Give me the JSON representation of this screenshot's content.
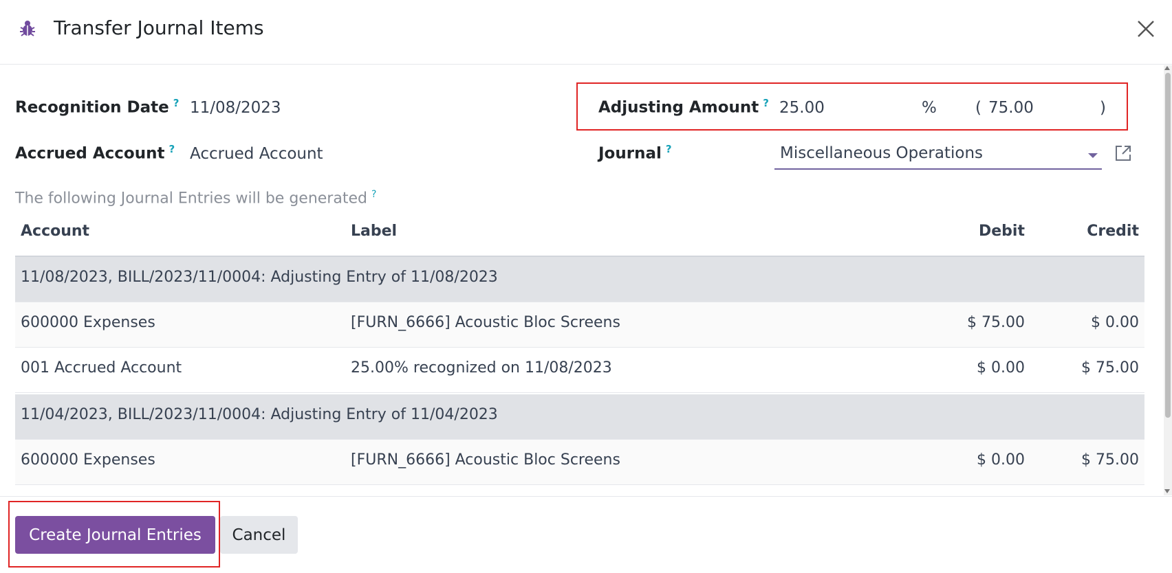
{
  "dialog": {
    "title": "Transfer Journal Items"
  },
  "form": {
    "recognition_date_label": "Recognition Date",
    "recognition_date_value": "11/08/2023",
    "accrued_account_label": "Accrued Account",
    "accrued_account_value": "Accrued Account",
    "adjusting_amount_label": "Adjusting Amount",
    "adjusting_amount_value": "25.00",
    "percent_symbol": "%",
    "amount_open_paren": "(",
    "amount_computed": "75.00",
    "amount_close_paren": ")",
    "journal_label": "Journal",
    "journal_value": "Miscellaneous Operations",
    "help_mark": "?"
  },
  "info_text": "The following Journal Entries will be generated",
  "table": {
    "columns": [
      "Account",
      "Label",
      "Debit",
      "Credit"
    ],
    "rows": [
      {
        "type": "group",
        "text": "11/08/2023, BILL/2023/11/0004: Adjusting Entry of 11/08/2023"
      },
      {
        "type": "line",
        "account": "600000 Expenses",
        "label": "[FURN_6666] Acoustic Bloc Screens",
        "debit": "$ 75.00",
        "credit": "$ 0.00"
      },
      {
        "type": "line",
        "account": "001 Accrued Account",
        "label": "25.00% recognized on 11/08/2023",
        "debit": "$ 0.00",
        "credit": "$ 75.00"
      },
      {
        "type": "group",
        "text": "11/04/2023, BILL/2023/11/0004: Adjusting Entry of 11/04/2023"
      },
      {
        "type": "line",
        "account": "600000 Expenses",
        "label": "[FURN_6666] Acoustic Bloc Screens",
        "debit": "$ 0.00",
        "credit": "$ 75.00"
      }
    ]
  },
  "footer": {
    "create_label": "Create Journal Entries",
    "cancel_label": "Cancel"
  },
  "icons": {
    "dialog_icon": "bug-icon",
    "close": "close-icon",
    "dropdown": "chevron-down-icon",
    "external": "external-link-icon"
  },
  "colors": {
    "primary": "#7b4fa0",
    "highlight": "#e02424",
    "help": "#17a2b8",
    "group_row": "#e0e2e6"
  }
}
